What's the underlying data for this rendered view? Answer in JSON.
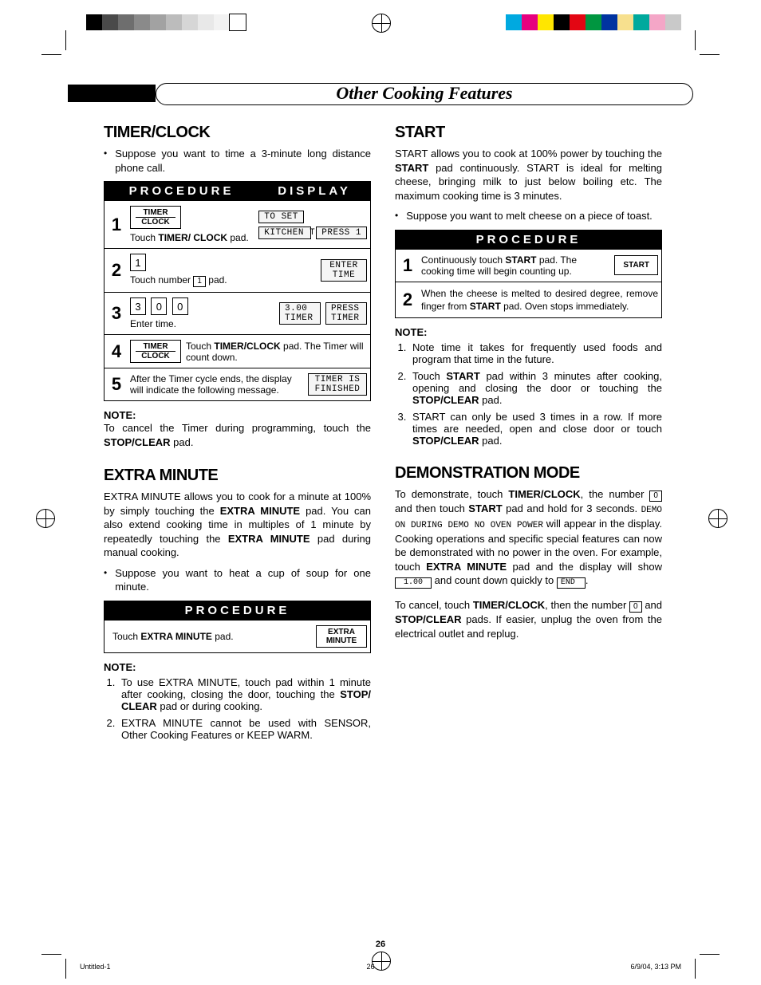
{
  "header": {
    "title": "Other Cooking Features"
  },
  "page_number": "26",
  "footer_meta": {
    "doc": "Untitled-1",
    "page": "26",
    "datetime": "6/9/04, 3:13 PM"
  },
  "color_swatches_left": [
    "#000000",
    "#4a4a4a",
    "#6e6e6e",
    "#8a8a8a",
    "#a2a2a2",
    "#bcbcbc",
    "#d6d6d6",
    "#e8e8e8",
    "#f2f2f2",
    "#ffffff"
  ],
  "color_swatches_right": [
    "#00a9e0",
    "#e6007e",
    "#ffe600",
    "#000000",
    "#e30613",
    "#009640",
    "#0033a0",
    "#f7e08e",
    "#00a99d",
    "#f4a6c7",
    "#c9c9c9"
  ],
  "left": {
    "timer": {
      "heading": "TIMER/CLOCK",
      "intro": "Suppose you want to time a 3-minute long distance phone call.",
      "col_procedure": "PROCEDURE",
      "col_display": "DISPLAY",
      "steps": {
        "s1": {
          "num": "1",
          "btn_line1": "TIMER",
          "btn_line2": "CLOCK",
          "text_prefix": "Touch ",
          "text_bold": "TIMER/ CLOCK",
          "text_suffix": " pad.",
          "disp1": "TO SET",
          "disp2a": "KITCHEN TIMER",
          "disp2b": "PRESS 1"
        },
        "s2": {
          "num": "2",
          "key": "1",
          "text_prefix": "Touch number ",
          "key_inline": "1",
          "text_suffix": " pad.",
          "disp": "ENTER TIME"
        },
        "s3": {
          "num": "3",
          "k1": "3",
          "k2": "0",
          "k3": "0",
          "text": "Enter time.",
          "disp_a": "3.00 TIMER",
          "disp_b": "PRESS TIMER"
        },
        "s4": {
          "num": "4",
          "btn_line1": "TIMER",
          "btn_line2": "CLOCK",
          "text_prefix": "Touch ",
          "text_bold": "TIMER/CLOCK",
          "text_suffix": " pad. The Timer will count down."
        },
        "s5": {
          "num": "5",
          "text": "After the Timer cycle ends, the display will indicate the following message.",
          "disp": "TIMER IS FINISHED"
        }
      },
      "note_label": "NOTE:",
      "note_text_a": "To cancel the Timer during programming, touch the ",
      "note_bold": "STOP/CLEAR",
      "note_text_b": " pad."
    },
    "extra": {
      "heading": "EXTRA MINUTE",
      "para_1a": "EXTRA MINUTE allows you to cook for a minute at 100% by simply touching the ",
      "para_1b": "EXTRA MINUTE",
      "para_1c": " pad. You can also extend cooking time in multiples of 1 minute by repeatedly touching the ",
      "para_1d": "EXTRA MINUTE",
      "para_1e": " pad during manual cooking.",
      "bullet": "Suppose you want to heat a cup of soup for one minute.",
      "col_procedure": "PROCEDURE",
      "step_text_a": "Touch ",
      "step_text_b": "EXTRA MINUTE",
      "step_text_c": " pad.",
      "btn_line1": "EXTRA",
      "btn_line2": "MINUTE",
      "note_label": "NOTE:",
      "note1_a": "To use EXTRA MINUTE, touch pad within 1 minute after cooking, closing the door, touching the ",
      "note1_b": "STOP/ CLEAR",
      "note1_c": " pad or during cooking.",
      "note2": "EXTRA MINUTE cannot be used with SENSOR, Other Cooking Features or KEEP WARM."
    }
  },
  "right": {
    "start": {
      "heading": "START",
      "para_a": "START allows you to cook at 100% power by  touching the ",
      "para_b": "START",
      "para_c": " pad continuously. START is ideal for melting cheese, bringing milk to just below boiling etc. The maximum cooking time is 3 minutes.",
      "bullet": "Suppose you want to melt cheese on a piece of toast.",
      "col_procedure": "PROCEDURE",
      "s1_num": "1",
      "s1_a": "Continuously touch ",
      "s1_b": "START",
      "s1_c": " pad. The cooking time will begin counting up.",
      "s1_btn": "START",
      "s2_num": "2",
      "s2_a": "When the cheese is melted to desired degree, remove finger from ",
      "s2_b": "START",
      "s2_c": " pad. Oven stops immediately.",
      "note_label": "NOTE:",
      "n1": "Note time it takes for frequently used foods and program that time in the future.",
      "n2_a": "Touch ",
      "n2_b": "START",
      "n2_c": " pad within 3 minutes after cooking, opening and closing the door or touching the ",
      "n2_d": "STOP/CLEAR",
      "n2_e": " pad.",
      "n3_a": "START can only be used 3 times in a row. If more times are needed, open and close door or touch ",
      "n3_b": "STOP/CLEAR",
      "n3_c": " pad."
    },
    "demo": {
      "heading": "DEMONSTRATION MODE",
      "p1_a": "To demonstrate, touch ",
      "p1_b": "TIMER/CLOCK",
      "p1_c": ", the number ",
      "p1_key0": "0",
      "p1_d": " and then touch ",
      "p1_e": "START",
      "p1_f": " pad and hold for 3 seconds. ",
      "p1_demo": "DEMO ON DURING DEMO NO OVEN POWER",
      "p1_g": " will appear in the display. Cooking operations and specific special features can now be demonstrated with no power in the oven. For example, touch ",
      "p1_h": "EXTRA MINUTE",
      "p1_i": " pad and the display will show ",
      "p1_lcd100": "1.00",
      "p1_j": " and count down quickly to ",
      "p1_lcd_end": "END",
      "p1_k": ".",
      "p2_a": "To cancel, touch ",
      "p2_b": "TIMER/CLOCK",
      "p2_c": ", then the number ",
      "p2_key0": "0",
      "p2_d": " and ",
      "p2_e": "STOP/CLEAR",
      "p2_f": " pads. If easier, unplug the oven from the electrical outlet and replug."
    }
  }
}
